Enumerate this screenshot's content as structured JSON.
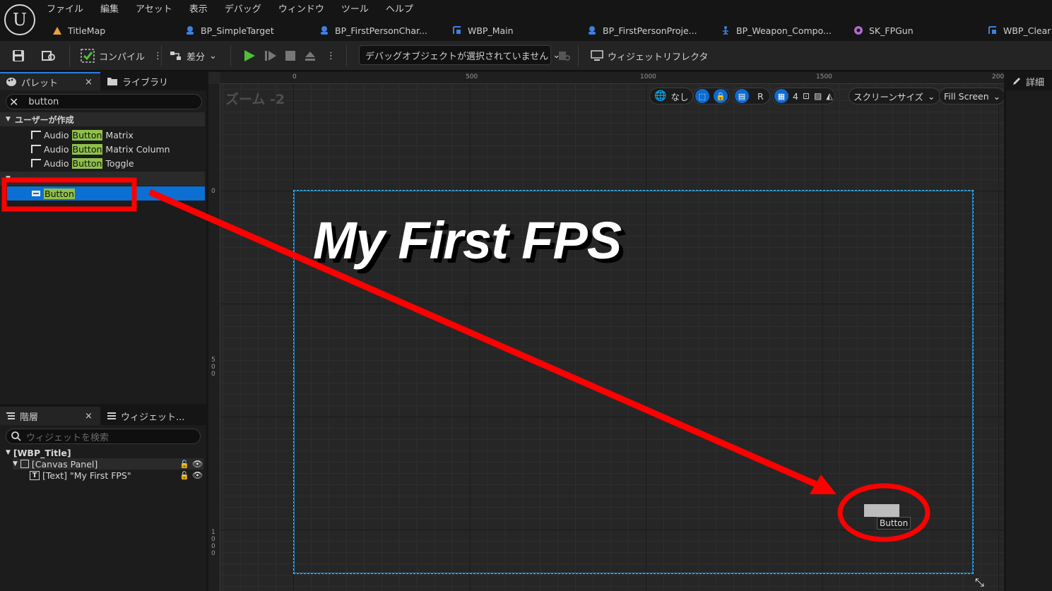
{
  "menu": [
    "ファイル",
    "編集",
    "アセット",
    "表示",
    "デバッグ",
    "ウィンドウ",
    "ツール",
    "ヘルプ"
  ],
  "tabs": [
    {
      "label": "TitleMap",
      "icon": "level-icon"
    },
    {
      "label": "BP_SimpleTarget",
      "icon": "blueprint-pawn-icon"
    },
    {
      "label": "BP_FirstPersonChar...",
      "icon": "blueprint-pawn-icon"
    },
    {
      "label": "WBP_Main",
      "icon": "widget-blueprint-icon"
    },
    {
      "label": "BP_FirstPersonProje...",
      "icon": "blueprint-pawn-icon"
    },
    {
      "label": "BP_Weapon_Compo...",
      "icon": "skeleton-icon"
    },
    {
      "label": "SK_FPGun",
      "icon": "skeletal-mesh-icon"
    },
    {
      "label": "WBP_Clear",
      "icon": "widget-blueprint-icon"
    }
  ],
  "toolbar": {
    "compile_label": "コンパイル",
    "diff_label": "差分",
    "debug_select": "デバッグオブジェクトが選択されていません",
    "widget_reflector": "ウィジェットリフレクタ"
  },
  "palette": {
    "tab_palette": "パレット",
    "tab_library": "ライブラリ",
    "search_value": "button",
    "category_user": "ユーザーが作成",
    "items": [
      {
        "pre": "Audio ",
        "hl": "Button",
        "post": " Matrix"
      },
      {
        "pre": "Audio ",
        "hl": "Button",
        "post": " Matrix Column"
      },
      {
        "pre": "Audio ",
        "hl": "Button",
        "post": " Toggle"
      }
    ],
    "selected_item": "Button"
  },
  "hierarchy": {
    "tab_hierarchy": "階層",
    "tab_widget": "ウィジェット...",
    "search_placeholder": "ウィジェットを検索",
    "root": "[WBP_Title]",
    "canvas": "[Canvas Panel]",
    "text_node": "[Text] \"My First FPS\""
  },
  "designer": {
    "zoom": "ズーム -2",
    "ruler_top": [
      "0",
      "500",
      "1000",
      "1500",
      "200"
    ],
    "ruler_left": [
      "0",
      "500",
      "1000"
    ],
    "locale_none": "なし",
    "r_label": "R",
    "grid_value": "4",
    "screen_size": "スクリーンサイズ",
    "fill_screen": "Fill Screen",
    "title_text": "My First FPS",
    "dropped_tooltip": "Button"
  },
  "details": {
    "tab": "詳細"
  },
  "colors": {
    "selection": "#0c6fd3",
    "highlight": "#8fc14a",
    "annotation": "#ff0000",
    "canvas_border": "#4fb7e8"
  }
}
